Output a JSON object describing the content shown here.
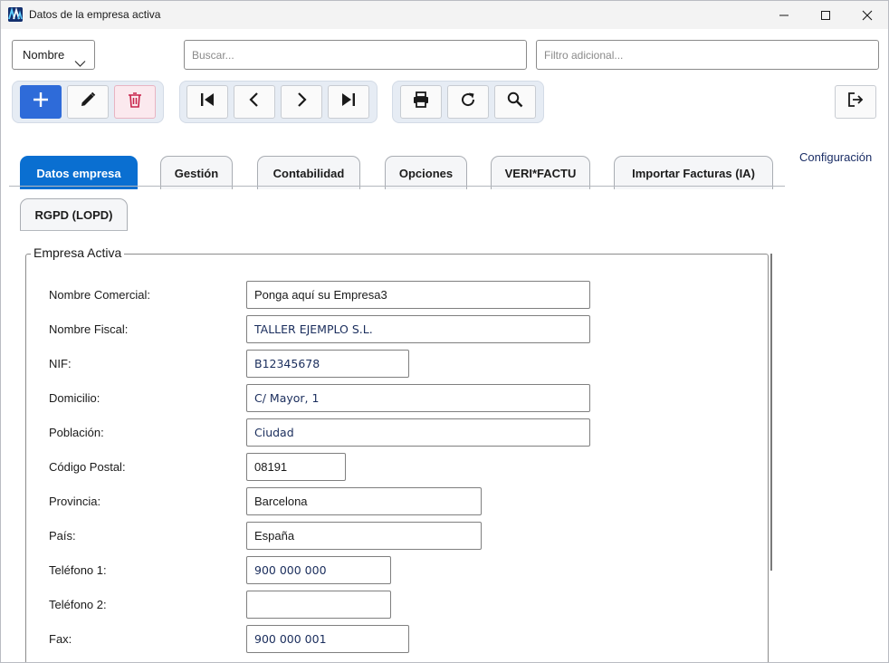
{
  "window": {
    "title": "Datos de la empresa activa"
  },
  "search": {
    "field_value": "Nombre",
    "search_placeholder": "Buscar...",
    "filter_placeholder": "Filtro adicional..."
  },
  "toolbar": {
    "icons": [
      "plus-icon",
      "pencil-icon",
      "trash-icon",
      "first-record-icon",
      "previous-icon",
      "next-icon",
      "last-record-icon",
      "print-icon",
      "refresh-icon",
      "search-icon",
      "exit-icon"
    ],
    "colors": {
      "primary": "#2e6bd9",
      "danger": "#c8234a",
      "group_bg": "#e6ecf4"
    }
  },
  "tabs": [
    {
      "label": "Datos empresa",
      "active": true
    },
    {
      "label": "Gestión",
      "active": false
    },
    {
      "label": "Contabilidad",
      "active": false
    },
    {
      "label": "Opciones",
      "active": false
    },
    {
      "label": "VERI*FACTU",
      "active": false
    },
    {
      "label": "Importar Facturas (IA)",
      "active": false
    },
    {
      "label": "RGPD (LOPD)",
      "active": false
    }
  ],
  "config_link": "Configuración",
  "group": {
    "title": "Empresa Activa",
    "fields": [
      {
        "label": "Nombre Comercial:",
        "value": "Ponga aquí su Empresa3"
      },
      {
        "label": "Nombre Fiscal:",
        "value": "TALLER EJEMPLO S.L."
      },
      {
        "label": "NIF:",
        "value": "B12345678"
      },
      {
        "label": "Domicilio:",
        "value": "C/ Mayor, 1"
      },
      {
        "label": "Población:",
        "value": "Ciudad"
      },
      {
        "label": "Código Postal:",
        "value": "08191"
      },
      {
        "label": "Provincia:",
        "value": "Barcelona"
      },
      {
        "label": "País:",
        "value": "España"
      },
      {
        "label": "Teléfono 1:",
        "value": "900 000 000"
      },
      {
        "label": "Teléfono 2:",
        "value": ""
      },
      {
        "label": "Fax:",
        "value": "900 000 001"
      }
    ]
  },
  "colors": {
    "accent": "#0a6fd1",
    "link": "#1b2e66"
  }
}
